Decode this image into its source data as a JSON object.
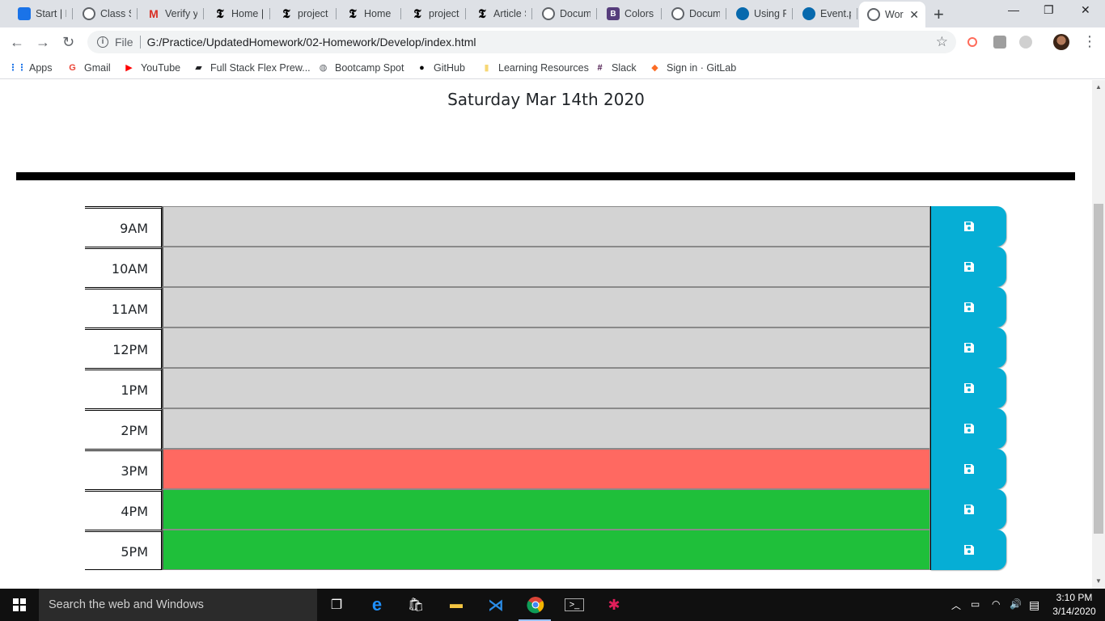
{
  "browser": {
    "tabs": [
      {
        "label": "Start | F",
        "icon": "blue-flag-icon",
        "color": "#1a73e8"
      },
      {
        "label": "Class Se",
        "icon": "globe-icon"
      },
      {
        "label": "Verify y",
        "icon": "gmail-icon",
        "color": "#d93025"
      },
      {
        "label": "Home |",
        "icon": "nyt-icon"
      },
      {
        "label": "project",
        "icon": "nyt-icon"
      },
      {
        "label": "Home |",
        "icon": "nyt-icon"
      },
      {
        "label": "project",
        "icon": "nyt-icon"
      },
      {
        "label": "Article S",
        "icon": "nyt-icon"
      },
      {
        "label": "Docum",
        "icon": "globe-icon"
      },
      {
        "label": "Colors",
        "icon": "bootstrap-icon",
        "color": "#563d7c"
      },
      {
        "label": "Docum",
        "icon": "globe-icon"
      },
      {
        "label": "Using F",
        "icon": "jquery-icon",
        "color": "#0769ad"
      },
      {
        "label": "Event.p",
        "icon": "jquery-icon",
        "color": "#0769ad"
      },
      {
        "label": "Wor",
        "icon": "globe-icon",
        "active": true
      }
    ],
    "tab_close": "✕",
    "new_tab": "+",
    "window_controls": {
      "minimize": "—",
      "restore": "❐",
      "close": "✕"
    },
    "address_bar": {
      "scheme_label": "File",
      "url": "G:/Practice/UpdatedHomework/02-Homework/Develop/index.html"
    },
    "bookmarks": [
      {
        "label": "Apps",
        "icon": "apps-grid-icon"
      },
      {
        "label": "Gmail",
        "icon": "google-icon"
      },
      {
        "label": "YouTube",
        "icon": "youtube-icon"
      },
      {
        "label": "Full Stack Flex Prew...",
        "icon": "book-icon"
      },
      {
        "label": "Bootcamp Spot",
        "icon": "globe-icon"
      },
      {
        "label": "GitHub",
        "icon": "github-icon"
      },
      {
        "label": "Learning Resources",
        "icon": "folder-icon"
      },
      {
        "label": "Slack",
        "icon": "slack-icon"
      },
      {
        "label": "Sign in · GitLab",
        "icon": "gitlab-icon"
      }
    ]
  },
  "page": {
    "current_day": "Saturday Mar 14th 2020",
    "colors": {
      "past": "#d3d3d3",
      "present": "#ff6961",
      "future": "#1fbf3a",
      "save": "#06aed5"
    },
    "time_blocks": [
      {
        "hour": "9AM",
        "status": "past",
        "text": ""
      },
      {
        "hour": "10AM",
        "status": "past",
        "text": ""
      },
      {
        "hour": "11AM",
        "status": "past",
        "text": ""
      },
      {
        "hour": "12PM",
        "status": "past",
        "text": ""
      },
      {
        "hour": "1PM",
        "status": "past",
        "text": ""
      },
      {
        "hour": "2PM",
        "status": "past",
        "text": ""
      },
      {
        "hour": "3PM",
        "status": "present",
        "text": ""
      },
      {
        "hour": "4PM",
        "status": "future",
        "text": ""
      },
      {
        "hour": "5PM",
        "status": "future",
        "text": ""
      }
    ]
  },
  "taskbar": {
    "search_placeholder": "Search the web and Windows",
    "time": "3:10 PM",
    "date": "3/14/2020"
  }
}
